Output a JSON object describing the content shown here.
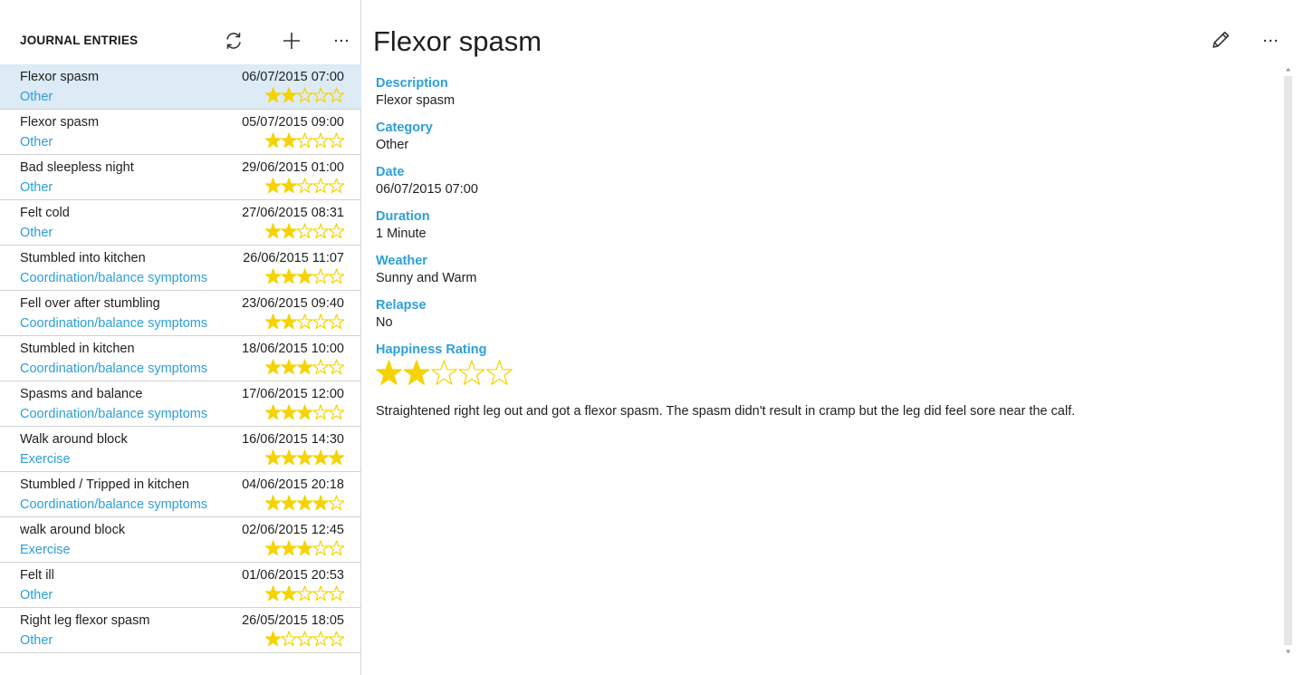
{
  "list": {
    "title": "JOURNAL ENTRIES",
    "refresh_icon": "refresh-icon",
    "add_icon": "add-icon",
    "more_icon": "more-icon",
    "entries": [
      {
        "title": "Flexor spasm",
        "date": "06/07/2015 07:00",
        "category": "Other",
        "rating": 2,
        "selected": true
      },
      {
        "title": "Flexor spasm",
        "date": "05/07/2015 09:00",
        "category": "Other",
        "rating": 2,
        "selected": false
      },
      {
        "title": "Bad sleepless night",
        "date": "29/06/2015 01:00",
        "category": "Other",
        "rating": 2,
        "selected": false
      },
      {
        "title": "Felt cold",
        "date": "27/06/2015 08:31",
        "category": "Other",
        "rating": 2,
        "selected": false
      },
      {
        "title": "Stumbled into kitchen",
        "date": "26/06/2015 11:07",
        "category": "Coordination/balance symptoms",
        "rating": 3,
        "selected": false
      },
      {
        "title": "Fell over after stumbling",
        "date": "23/06/2015 09:40",
        "category": "Coordination/balance symptoms",
        "rating": 2,
        "selected": false
      },
      {
        "title": "Stumbled in kitchen",
        "date": "18/06/2015 10:00",
        "category": "Coordination/balance symptoms",
        "rating": 3,
        "selected": false
      },
      {
        "title": "Spasms and balance",
        "date": "17/06/2015 12:00",
        "category": "Coordination/balance symptoms",
        "rating": 3,
        "selected": false
      },
      {
        "title": "Walk around block",
        "date": "16/06/2015 14:30",
        "category": "Exercise",
        "rating": 5,
        "selected": false
      },
      {
        "title": "Stumbled / Tripped in kitchen",
        "date": "04/06/2015 20:18",
        "category": "Coordination/balance symptoms",
        "rating": 4,
        "selected": false
      },
      {
        "title": "walk around block",
        "date": "02/06/2015 12:45",
        "category": "Exercise",
        "rating": 3,
        "selected": false
      },
      {
        "title": "Felt ill",
        "date": "01/06/2015 20:53",
        "category": "Other",
        "rating": 2,
        "selected": false
      },
      {
        "title": "Right leg flexor spasm",
        "date": "26/05/2015 18:05",
        "category": "Other",
        "rating": 1,
        "selected": false
      }
    ]
  },
  "detail": {
    "title": "Flexor spasm",
    "edit_icon": "edit-pencil-icon",
    "more_icon": "more-icon",
    "fields": [
      {
        "label": "Description",
        "value": "Flexor spasm"
      },
      {
        "label": "Category",
        "value": "Other"
      },
      {
        "label": "Date",
        "value": "06/07/2015 07:00"
      },
      {
        "label": "Duration",
        "value": "1 Minute"
      },
      {
        "label": "Weather",
        "value": "Sunny and Warm"
      },
      {
        "label": "Relapse",
        "value": "No"
      }
    ],
    "rating_label": "Happiness Rating",
    "rating": 2,
    "rating_max": 5,
    "notes": "Straightened right leg out and got a flexor spasm. The spasm didn't result in cramp but the leg did feel sore near the calf."
  },
  "colors": {
    "accent": "#2d9fd8",
    "star": "#f5d300",
    "selected_row": "#dcebf5"
  }
}
